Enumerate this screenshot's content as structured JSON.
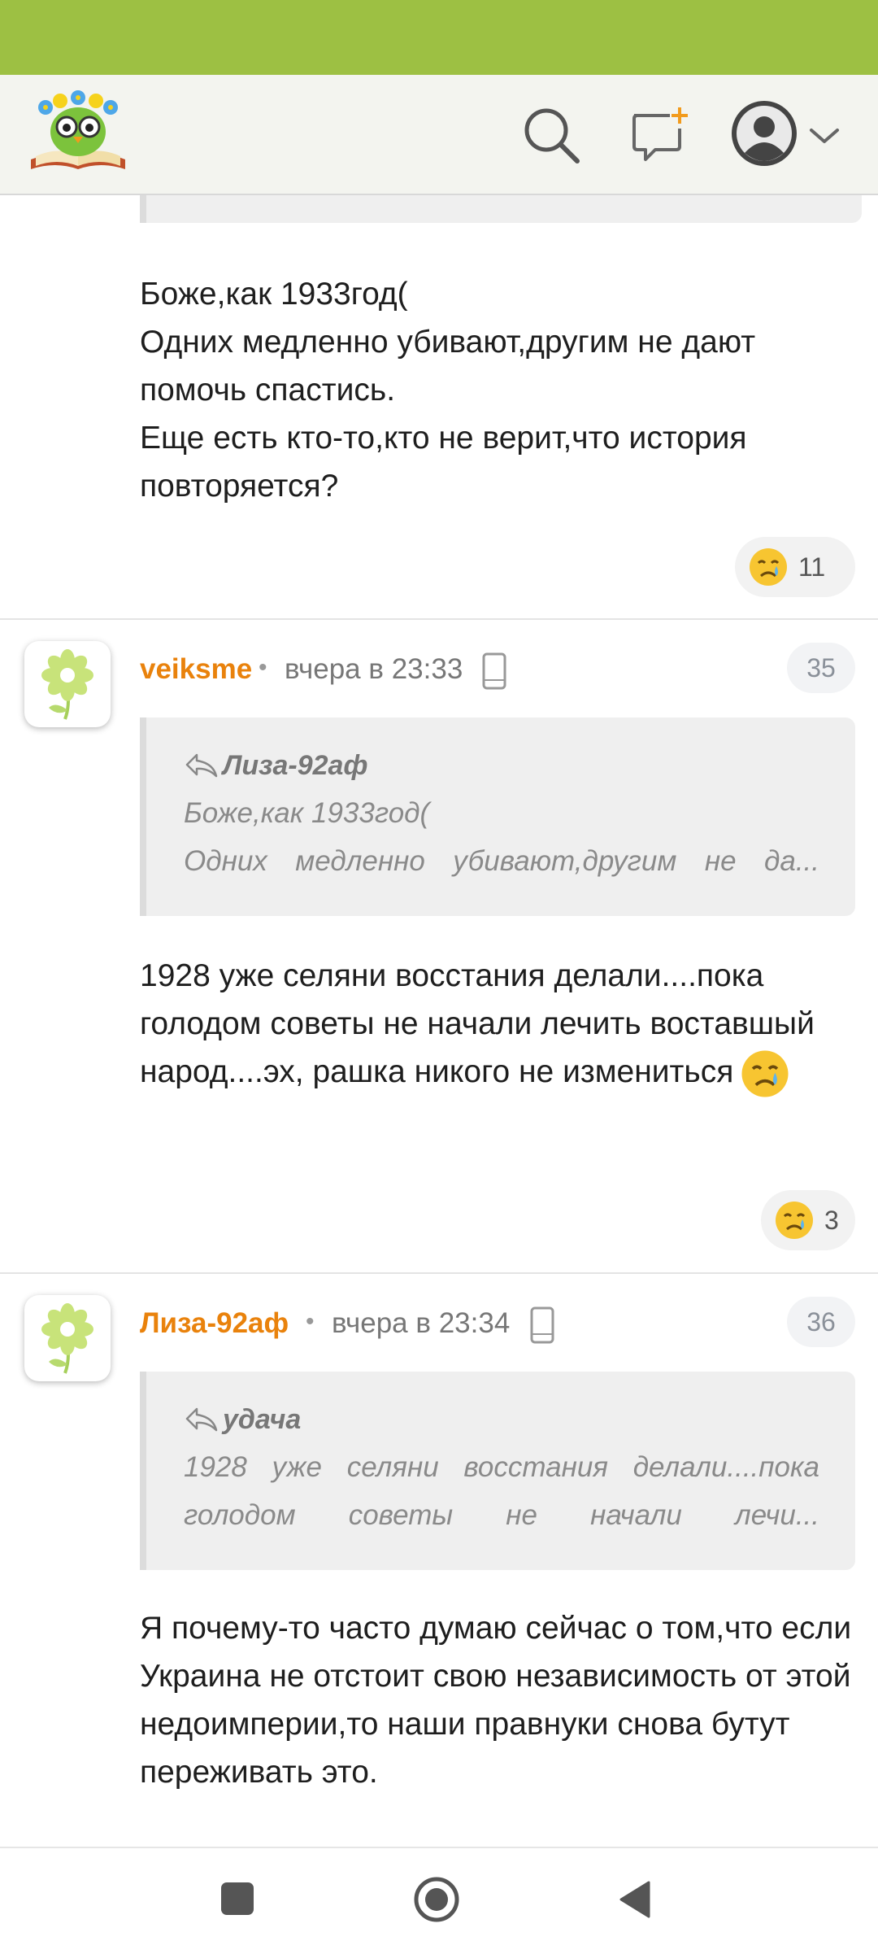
{
  "header": {
    "logo": "owl-reading-book-logo",
    "search_icon": "search-icon",
    "new_post_icon": "new-message-icon",
    "profile_icon": "avatar-icon",
    "menu_icon": "chevron-down-icon"
  },
  "colors": {
    "status_bar": "#9dc043",
    "author": "#e9820c",
    "header_bg": "#f3f4ef"
  },
  "comments": [
    {
      "text": "Боже,как 1933год(\nОдних медленно убивают,другим не дают помочь спастись.\nЕще есть кто-то,кто не верит,что история повторяется?",
      "reaction": {
        "emoji": "crying-face",
        "count": "11"
      }
    },
    {
      "author": "veiksme",
      "time": "вчера в 23:33",
      "number": "35",
      "quote": {
        "author": "Лиза-92аф",
        "line1": "Боже,как 1933год(",
        "line2": "Одних медленно убивают,другим не да..."
      },
      "text": "1928 уже селяни восстания делали....пока голодом советы не начали лечить воставшый народ....эх, рашка никого не измениться",
      "reaction": {
        "emoji": "crying-face",
        "count": "3"
      }
    },
    {
      "author": "Лиза-92аф",
      "time": "вчера в 23:34",
      "number": "36",
      "quote": {
        "author": "удача",
        "line1": "1928 уже селяни восстания делали....пока",
        "line2": "голодом советы не начали лечи..."
      },
      "text": "Я почему-то часто думаю сейчас о том,что если Украина не отстоит свою независимость от этой недоимперии,то наши правнуки снова бутут переживать это."
    }
  ],
  "navbar": {
    "recents": "square-icon",
    "home": "circle-icon",
    "back": "triangle-back-icon"
  }
}
